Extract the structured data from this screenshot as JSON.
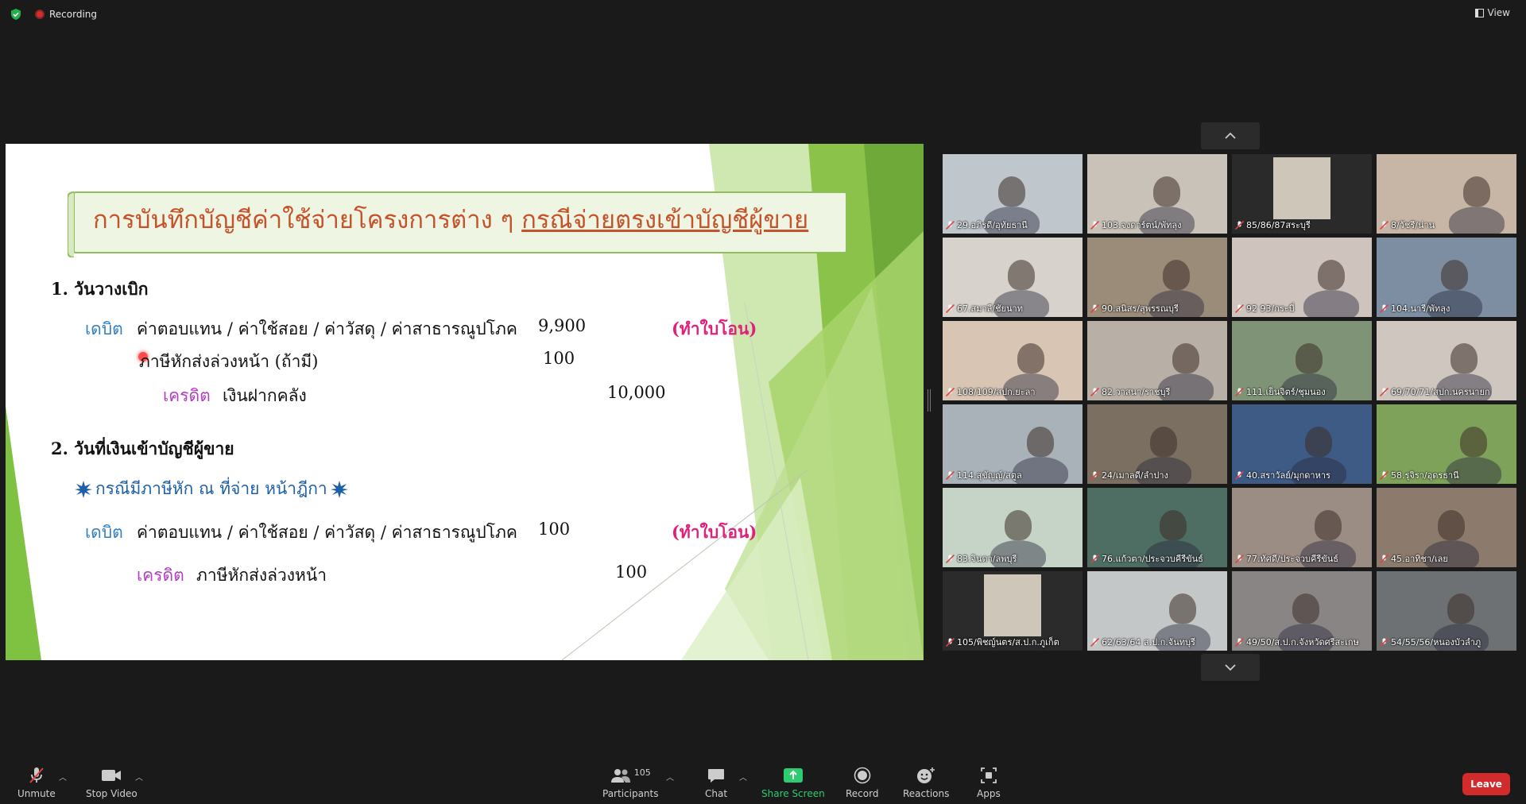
{
  "topbar": {
    "recording": "Recording",
    "view": "View"
  },
  "slide": {
    "title_part1": "การบันทึกบัญชีค่าใช้จ่ายโครงการต่าง ๆ ",
    "title_part2": "กรณีจ่ายตรงเข้าบัญชีผู้ขาย",
    "sec1": "1. วันวางเบิก",
    "r1_debit": "เดบิต",
    "r1_text": "ค่าตอบแทน / ค่าใช้สอย / ค่าวัสดุ / ค่าสาธารณูปโภค",
    "r1_amt": "9,900",
    "r1_note": "(ทำใบโอน)",
    "r2_text": "ภาษีหักส่งล่วงหน้า (ถ้ามี)",
    "r2_amt": "100",
    "r3_credit": "เครดิต",
    "r3_text": "เงินฝากคลัง",
    "r3_amt": "10,000",
    "sec2": "2. วันที่เงินเข้าบัญชีผู้ขาย",
    "case": "กรณีมีภาษีหัก ณ ที่จ่าย หน้าฎีกา",
    "r4_debit": "เดบิต",
    "r4_text": "ค่าตอบแทน / ค่าใช้สอย / ค่าวัสดุ / ค่าสาธารณูปโภค",
    "r4_amt": "100",
    "r4_note": "(ทำใบโอน)",
    "r5_credit": "เครดิต",
    "r5_text": "ภาษีหักส่งล่วงหน้า",
    "r5_amt": "100"
  },
  "participants_grid": [
    {
      "name": "29.อภิรดี/อุทัยธานี",
      "bg": "#bfc6cc"
    },
    {
      "name": "103.จงดาร์ตน์/พัทลุง",
      "bg": "#c9c2b8"
    },
    {
      "name": "85/86/87สระบุรี",
      "bg": "#2a2a2a"
    },
    {
      "name": "8/วัชรี/น่าน",
      "bg": "#c7b6a5"
    },
    {
      "name": "67.สมาลี/ชัยนาท",
      "bg": "#d7d2cc"
    },
    {
      "name": "90.สนิสร/สุพรรณบุรี",
      "bg": "#9b8b79"
    },
    {
      "name": "92 93/กระบี่",
      "bg": "#cfc4bd"
    },
    {
      "name": "104.นารี/พัทลุง",
      "bg": "#7d8ea3"
    },
    {
      "name": "108/109/สปก.ยะลา",
      "bg": "#d8c5b4"
    },
    {
      "name": "82.วาสนา/ราชบุรี",
      "bg": "#b8b0a6"
    },
    {
      "name": "111.เย็นจิตร์/ชุมนอง",
      "bg": "#7f9476"
    },
    {
      "name": "69/70/71/สปก.นครนายก",
      "bg": "#cfc7bf"
    },
    {
      "name": "114.สุขัญญ์/สตูล",
      "bg": "#a9b2b9"
    },
    {
      "name": "24/เมาลดี/ลำปาง",
      "bg": "#7b6f61"
    },
    {
      "name": "40.สราวัลย์/มุกดาหาร",
      "bg": "#3e5b86"
    },
    {
      "name": "58.รุจิรา/อุดรธานี",
      "bg": "#7fa25a"
    },
    {
      "name": "83.จินดา/ลพบุรี",
      "bg": "#c6d4c7"
    },
    {
      "name": "76.แก้วตา/ประจวบคีรีขันธ์",
      "bg": "#4e6d63"
    },
    {
      "name": "77.ทัศดี/ประจวบคีรีขันธ์",
      "bg": "#9b8c84"
    },
    {
      "name": "45.อาทิชา/เลย",
      "bg": "#8c7b6c"
    },
    {
      "name": "105/พิชญ์นตร/ส.ป.ก.ภูเก็ต",
      "bg": "#2b2b2b"
    },
    {
      "name": "62/63/64 ส.ป.ก.จันทบุรี",
      "bg": "#c4c7c8"
    },
    {
      "name": "49/50/ส.ป.ก.จังหวัดศรีสะเกษ",
      "bg": "#8a8585"
    },
    {
      "name": "54/55/56/หนองบัวลำภู",
      "bg": "#6d7173"
    }
  ],
  "toolbar": {
    "unmute": "Unmute",
    "stop_video": "Stop Video",
    "participants": "Participants",
    "participants_count": "105",
    "chat": "Chat",
    "share_screen": "Share Screen",
    "record": "Record",
    "reactions": "Reactions",
    "apps": "Apps",
    "leave": "Leave"
  },
  "colors": {
    "share_green": "#2ecc71",
    "leave_red": "#d22b2b",
    "slide_green": "#8bc34a"
  }
}
